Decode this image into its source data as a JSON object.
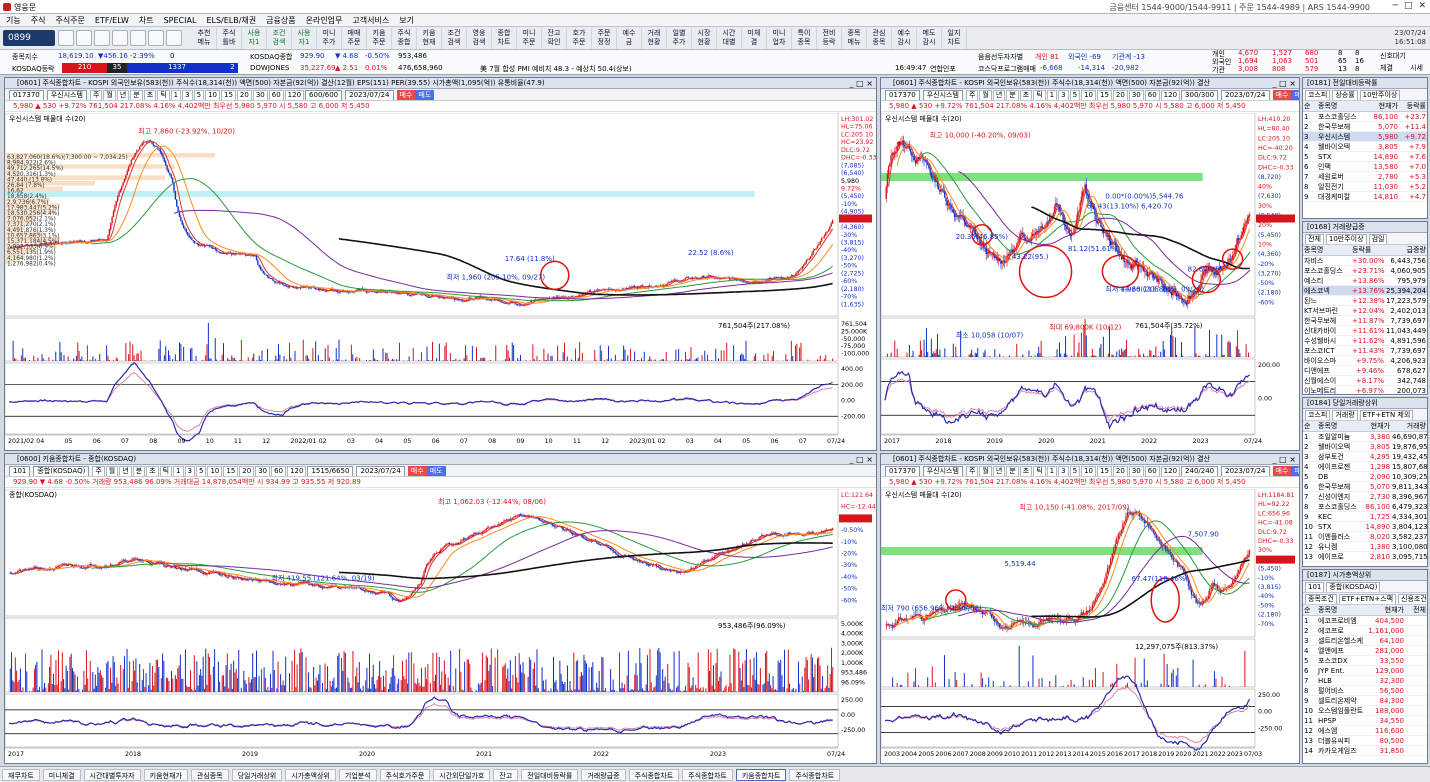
{
  "window": {
    "title": "영웅문",
    "center_info": "금융센터 1544-9000/1544-9911 | 주문 1544-4989 | ARS 1544-9900"
  },
  "menu": [
    "기능",
    "주식",
    "주식주문",
    "ETF/ELW",
    "차트",
    "SPECIAL",
    "ELS/ELB/채권",
    "금융상품",
    "온라인업무",
    "고객서비스",
    "보기"
  ],
  "toolbar": {
    "screen_no": "0899",
    "buttons": [
      "추천\n메뉴",
      "주식\n틀바",
      "사용\n자1",
      "조건\n검색",
      "사용\n자1",
      "미니\n주가",
      "매매\n주문",
      "키움\n주문",
      "주식\n종합",
      "키움\n현재",
      "조건\n검색",
      "영웅\n검색",
      "종합\n차트",
      "미니\n주문",
      "잔고\n확인",
      "호가\n주문",
      "주문\n정정",
      "예수\n금",
      "거래\n현황",
      "일별\n주가",
      "시장\n현황",
      "시간\n대별",
      "미체\n결",
      "미니\n업차",
      "특이\n종목",
      "전비\n등락",
      "종목\n메뉴",
      "관심\n종목",
      "예수\n감시",
      "메도\n감시",
      "일지\n차트"
    ],
    "date": "23/07/24",
    "time": "16:51:08"
  },
  "tickers": {
    "row1": [
      {
        "name": "종목지수",
        "v1": "18,619.10",
        "chg": "▼456.16",
        "pct": "-2.39%",
        "vol": "0"
      },
      {
        "name": "KOSDAQ종합",
        "v1": "929.90",
        "chg": "▼ 4.68",
        "pct": "-0.50%",
        "vol": "953,486"
      },
      {
        "name": "DOWJONES",
        "v1": "35,227.69",
        "chg": "▲ 2.51",
        "pct": "0.01%",
        "vol": "476,658,960"
      }
    ],
    "row1b": {
      "name": "음음선두자자별",
      "a": "개인 81",
      "b": "외국인 -69",
      "c": "기관계 -13"
    },
    "row2b": {
      "name": "코스닥프로그램매매",
      "a": "-6,668",
      "b": "-14,314",
      "c": "-20,982"
    },
    "kosdaq_box": {
      "label": "KOSDAQ등락",
      "up": "210",
      "flat": "35",
      "down": "1337",
      "down2": "2"
    },
    "clock2": "16:49:47",
    "notice": "연합인포",
    "notice2": "美 7월 합성 PMI 예비치 48.3 - 예상치 50.4(상보)",
    "investors": {
      "labels": [
        "개인",
        "외국인",
        "기관"
      ],
      "a": [
        "4,670",
        "1,694",
        "3,008"
      ],
      "b": [
        "1,527",
        "1,063",
        "808"
      ],
      "c": [
        "680",
        "501",
        "579"
      ],
      "d": [
        "8",
        "65",
        "13"
      ],
      "e": [
        "8",
        "16",
        "8"
      ],
      "f": "신호대기",
      "g": "체결",
      "h": "시세"
    }
  },
  "chart_tl": {
    "header": "[0601] 주식종합차트 - KOSPI 외국인보유(583(천)) 주식수(18,314(천)) 액면(500) 자본금(92(억)) 결산(12월) EPS(151) PER(39.55) 시가총액(1,095(억)) 유통비율(47.9)",
    "code": "017370",
    "name": "우신시스템",
    "period": "600/600",
    "date": "2023/07/24",
    "quote": "5,980 ▲ 530 +9.72% 761,504 217.08% 4.16% 4,402백만 최우선 5,980 5,970 시 5,580 고 6,000 저 5,450",
    "legend": "우신시스템 매물대 수(20)",
    "high_note": "최고 7,860 (-23.92%, 10/20)",
    "low_note": "최저 1,960 (205.10%, 09/27)",
    "vol_note": "761,504주(217.08%)",
    "profile": [
      "63,827,060(18.6%)(7,300.00 ~ 7,034.25)",
      "8,984,922(2.6%)",
      "49,712,265(14.5%)",
      "4,520,316(1.3%)",
      "47,440,(13.8%)",
      "26,84 (7.8%)",
      "16,62",
      "18,858(2.4%)",
      "2,9,736(6.7%)",
      "17,983,447(5.2%)",
      "18,530,256(4.4%)",
      "7,076,052(2.1%)",
      "7,371,270(2.1%)",
      "4,491,876(1.3%)",
      "10,657,863(3.1%)",
      "15,371,184(4.5%)",
      "2,992,133(0.9%)",
      "6,551,135(1.9%)",
      "4,164,980(1.2%)",
      "1,276,982(0.4%)"
    ],
    "price_scale": [
      "LH:301.02",
      "HL=75.06",
      "LC:205.10",
      "HC=23.92",
      "DLC:9.72",
      "DHC=-0.33",
      "(7,085)",
      "(6,540)",
      "5,980",
      "9.72%",
      "(5,450)",
      "-10%",
      "(4,905)",
      "-20%",
      "(4,360)",
      "-30%",
      "(3,815)",
      "-40%",
      "(3,270)",
      "-50%",
      "(2,725)",
      "-60%",
      "(2,180)",
      "-70%",
      "(1,635)"
    ],
    "ind_scale": [
      "400.00",
      "200.00",
      "0.00",
      "-200.00"
    ],
    "vol_scale": [
      "761,504",
      "25,000K",
      "-50,000",
      "-75,000",
      "-100,000"
    ],
    "xlabels": [
      "2021/02",
      "04",
      "05",
      "06",
      "07",
      "08",
      "09",
      "10",
      "11",
      "12",
      "2022/01",
      "02",
      "03",
      "04",
      "05",
      "06",
      "07",
      "08",
      "09",
      "10",
      "11",
      "12",
      "2023/01",
      "02",
      "03",
      "04",
      "05",
      "06",
      "07",
      "07/24"
    ],
    "annot": [
      "17.64 (11.8%)",
      "22.52 (8.6%)"
    ]
  },
  "chart_tr": {
    "header": "[0601] 주식종합차트 - KOSPI 외국인보유(583(천)) 주식수(18,314(천)) 액면(500) 자본금(92(억)) 결산",
    "code": "017370",
    "name": "우신시스템",
    "period": "300/300",
    "date": "2023/07/24",
    "quote": "5,980 ▲ 530 +9.72% 761,504 217.08% 4.16% 4,402백만 최우선 5,980 5,970 시 5,580 고 6,000 저 5,450",
    "legend": "우신시스템 매물대 수(20)",
    "high_note": "최고 10,000 (-40.20%, 09/03)",
    "low_note": "최저 1,960 (205.10%, 09/20)",
    "vol_note": "761,504주(35.72%)",
    "vol_high": "최대 69,800K (10/12)",
    "vol_low": "최소 10,058 (10/07)",
    "annot": [
      "0.00*(0.00%)5,544.76",
      "63.43(13.10%) 6,420.70",
      "20.35(46.85%)",
      "43.22(95.)",
      "81.12(51.61%)",
      "44.26(113.88%)",
      "82.67(85)"
    ],
    "price_scale": [
      "LH:410.20",
      "HL=80.40",
      "LC:205.10",
      "HC=-40.20",
      "DLC:9.72",
      "DHC=-0.33",
      "(8,720)",
      "40%",
      "(7,630)",
      "30%",
      "(6,540)",
      "20%",
      "(5,450)",
      "10%",
      "(4,360)",
      "-20%",
      "(3,270)",
      "-50%",
      "(2,180)",
      "-60%"
    ],
    "ind_scale": [
      "200.00",
      "0.00"
    ],
    "xlabels": [
      "2017",
      "2018",
      "2019",
      "2020",
      "2021",
      "2022",
      "2023",
      "07/24"
    ]
  },
  "chart_bl": {
    "header": "[0600] 키움종합차트 - 종합(KOSDAQ)",
    "code": "101",
    "name": "종합(KOSDAQ)",
    "period": "1515/6650",
    "date": "2023/07/24",
    "quote": "929.90 ▼ 4.68 -0.50% 거래량 953,486 96.09% 거래대금 14,878,054백만 시 934.99 고 935.55 저 920.89",
    "legend": "종합(KOSDAQ)",
    "high_note": "최고 1,062.03 (-12.44%, 08/06)",
    "low_note": "최저 419.55 (121.64%, 03/19)",
    "vol_note": "953,486주(96.09%)",
    "price_scale": [
      "LC:121.64",
      "HC=-12.44",
      "929.90",
      "-0.50%",
      "-10%",
      "-20%",
      "-30%",
      "-40%",
      "-50%",
      "-60%"
    ],
    "vol_scale": [
      "5,000K",
      "4,000K",
      "3,000K",
      "2,000K",
      "1,000K",
      "953,486",
      "96.09%"
    ],
    "ind_scale": [
      "250.00",
      "0.00",
      "-250.00"
    ],
    "xlabels": [
      "2017",
      "2018",
      "2019",
      "2020",
      "2021",
      "2022",
      "2023",
      "07/24"
    ]
  },
  "chart_br": {
    "header": "[0601] 주식종합차트 - KOSPI 외국인보유(583(천)) 주식수(18,314(천)) 액면(500) 자본금(92(억)) 결산",
    "code": "017370",
    "name": "우신시스템",
    "period": "240/240",
    "date": "2023/07/24",
    "quote": "5,980 ▲ 530 +9.72% 761,504 217.08% 4.16% 4,402백만 최우선 5,980 5,970 시 5,580 고 6,000 저 5,450",
    "legend": "우신시스템 매물대 수(20)",
    "high_note": "최고 10,150 (-41.08%, 2017/09)",
    "low_note": "최저 790 (656.96%, 2008/08)",
    "vol_note": "12,297,075주(813.37%)",
    "annot": [
      "5,519.44",
      "67.47(118.46%)",
      "7,507.90"
    ],
    "price_scale": [
      "LH:1184.81",
      "HL=92.22",
      "LC:656.96",
      "HC=-41.08",
      "DLC:9.72",
      "DHC=-0.33",
      "30%",
      "(7,085)",
      "(5,450)",
      "-10%",
      "(3,815)",
      "-40%",
      "-50%",
      "(2,180)",
      "-70%"
    ],
    "ind_scale": [
      "250.00",
      "0.00",
      "-250.00"
    ],
    "xlabels": [
      "2003",
      "2004",
      "2005",
      "2006",
      "2007",
      "2008",
      "2009",
      "2010",
      "2011",
      "2012",
      "2013",
      "2014",
      "2015",
      "2016",
      "2017",
      "2018",
      "2019",
      "2020",
      "2021",
      "2022",
      "2023",
      "07/03"
    ]
  },
  "panel_up": {
    "header": "[0181] 전일대비등락률",
    "filters": [
      "코스피",
      "상승률",
      "10만주이상"
    ],
    "cols": [
      "순위",
      "종목명",
      "현재가",
      "등락률"
    ],
    "rows": [
      [
        "1",
        "포스코홀딩스",
        "86,100",
        "+23.7"
      ],
      [
        "2",
        "한국무보헤",
        "5,070",
        "+11.4"
      ],
      [
        "3",
        "우신시스템",
        "5,980",
        "+9.72"
      ],
      [
        "4",
        "웰바이오텍",
        "3,805",
        "+7.9"
      ],
      [
        "5",
        "STX",
        "14,890",
        "+7.6"
      ],
      [
        "6",
        "인팩",
        "13,580",
        "+7.0"
      ],
      [
        "7",
        "세원로버",
        "2,780",
        "+5.3"
      ],
      [
        "8",
        "일진전기",
        "11,030",
        "+5.2"
      ],
      [
        "9",
        "대경케미칼",
        "14,810",
        "+4.7"
      ]
    ]
  },
  "panel_vol": {
    "header": "[0168] 거래량급증",
    "filters": [
      "전체",
      "10만주이상",
      "검일"
    ],
    "cols": [
      "종목명",
      "등락률",
      "급증량"
    ],
    "rows": [
      [
        "자비스",
        "+30.00%",
        "6,443,756"
      ],
      [
        "포스코홀딩스",
        "+23.71%",
        "4,060,905"
      ],
      [
        "예스티",
        "+13.86%",
        "795,979"
      ],
      [
        "에스코넥",
        "+13.76%",
        "25,394,204"
      ],
      [
        "된느",
        "+12.38%",
        "17,223,579"
      ],
      [
        "KT서브마린",
        "+12.04%",
        "2,402,013"
      ],
      [
        "한국무보헤",
        "+11.87%",
        "7,739,697"
      ],
      [
        "신대카바이",
        "+11.61%",
        "11,043,449"
      ],
      [
        "수성웰바시",
        "+11.62%",
        "4,891,596"
      ],
      [
        "포스코ICT",
        "+11.43%",
        "7,739,697"
      ],
      [
        "바이오스마",
        "+9.75%",
        "4,206,923"
      ],
      [
        "디앤에프",
        "+9.46%",
        "678,627"
      ],
      [
        "신월에스이",
        "+8.17%",
        "342,748"
      ],
      [
        "이노메트리",
        "+6.97%",
        "200,073"
      ]
    ]
  },
  "panel_day": {
    "header": "[0184] 당일거래량상위",
    "filters": [
      "코스피",
      "거래량",
      "ETF+ETN 제외"
    ],
    "cols": [
      "순위",
      "종목명",
      "현재가",
      "거래량"
    ],
    "rows": [
      [
        "1",
        "조일알미늄",
        "3,380",
        "46,690,873"
      ],
      [
        "2",
        "웰바이오텍",
        "3,805",
        "19,876,950"
      ],
      [
        "3",
        "삼부토건",
        "4,295",
        "19,432,456"
      ],
      [
        "4",
        "에이프로젠",
        "1,298",
        "15,807,689"
      ],
      [
        "5",
        "DB",
        "2,090",
        "10,309,250"
      ],
      [
        "6",
        "한국무보헤",
        "5,070",
        "9,811,343"
      ],
      [
        "7",
        "신성이엔지",
        "2,730",
        "8,396,967"
      ],
      [
        "8",
        "포스코홀딩스",
        "86,100",
        "6,479,323"
      ],
      [
        "9",
        "KEC",
        "1,725",
        "4,334,301"
      ],
      [
        "10",
        "STX",
        "14,890",
        "3,804,123"
      ],
      [
        "11",
        "이엔플러스",
        "8,020",
        "3,582,237"
      ],
      [
        "12",
        "유니켐",
        "1,380",
        "3,100,080"
      ],
      [
        "13",
        "에이프로",
        "2,810",
        "3,095,715"
      ]
    ]
  },
  "panel_cap": {
    "header": "[0187] 시가총액상위",
    "filters": [
      "101",
      "종합(KOSDAQ)"
    ],
    "filters2": [
      "종목조건",
      "ETF+ETN+스팩",
      "신용조건",
      "전체"
    ],
    "cols": [
      "순위",
      "종목명",
      "현재가",
      "전체"
    ],
    "rows": [
      [
        "1",
        "에코프로비엠",
        "404,500",
        ""
      ],
      [
        "2",
        "에코프로",
        "1,161,000",
        ""
      ],
      [
        "3",
        "셀트리온헬스케",
        "64,100",
        ""
      ],
      [
        "4",
        "엘앤에프",
        "281,000",
        ""
      ],
      [
        "5",
        "포스코DX",
        "33,550",
        ""
      ],
      [
        "6",
        "JYP Ent.",
        "129,000",
        ""
      ],
      [
        "7",
        "HLB",
        "32,300",
        ""
      ],
      [
        "8",
        "펄어비스",
        "56,500",
        ""
      ],
      [
        "9",
        "셀트리온제약",
        "84,300",
        ""
      ],
      [
        "10",
        "오스템임플란트",
        "188,000",
        ""
      ],
      [
        "11",
        "HPSP",
        "34,550",
        ""
      ],
      [
        "12",
        "에스엠",
        "116,600",
        ""
      ],
      [
        "13",
        "더블유씨피",
        "80,500",
        ""
      ],
      [
        "14",
        "카카오게임즈",
        "31,850",
        ""
      ]
    ]
  },
  "taskbar": [
    "재무차트",
    "미니체결",
    "시간대별투자자",
    "키움현재가",
    "관심종목",
    "당일거래상위",
    "시가총액상위",
    "기업분석",
    "주식호가주문",
    "시간외단일가호",
    "잔고",
    "전일대비등락률",
    "거래량급증",
    "주식종합차트",
    "주식종합차트",
    "키움종합차트",
    "주식종합차트"
  ],
  "colors": {
    "up": "#d8141c",
    "down": "#1030c8",
    "ma5": "#e0342a",
    "ma20": "#ff8c1a",
    "ma60": "#2a9a3a",
    "ma120": "#7a2a9a",
    "ma240": "#111111"
  }
}
